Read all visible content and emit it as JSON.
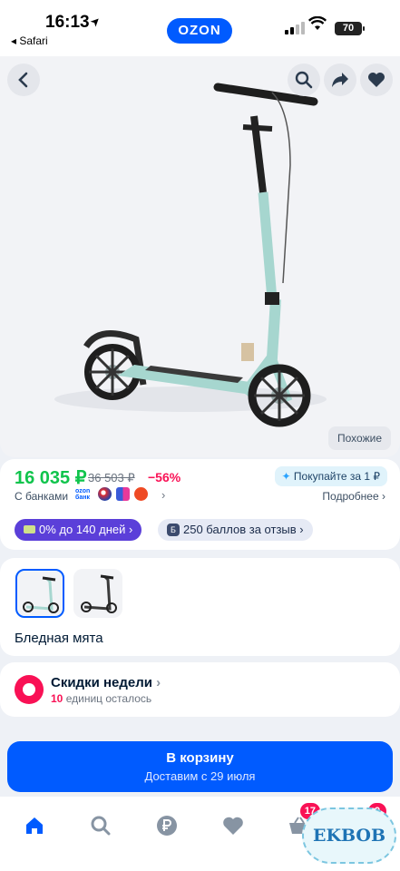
{
  "status_bar": {
    "time": "16:13",
    "back_app": "◂ Safari",
    "brand": "OZON",
    "battery": "70"
  },
  "product": {
    "similar_label": "Похожие",
    "price": "16 035 ₽",
    "old_price": "36 503 ₽",
    "discount": "−56%",
    "buy_for_label": "Покупайте за 1 ₽",
    "banks_label": "С банками",
    "ozon_bank_label": "ozon банк",
    "more_label": "Подробнее",
    "installment_label": "0% до 140 дней",
    "points_badge": "Б",
    "review_points_label": "250 баллов за отзыв",
    "color_name": "Бледная мята"
  },
  "deals": {
    "title": "Скидки недели",
    "count": "10",
    "subtitle_rest": "единиц осталось"
  },
  "cart": {
    "button_label": "В корзину",
    "delivery": "Доставим с 29 июля"
  },
  "tabbar": {
    "cart_badge": "17",
    "profile_badge": "9"
  },
  "watermark": "EKBOB",
  "colors": {
    "brand_blue": "#005bff",
    "price_green": "#10c44c",
    "discount_pink": "#f91155",
    "installment_purple": "#5b3fd9"
  }
}
